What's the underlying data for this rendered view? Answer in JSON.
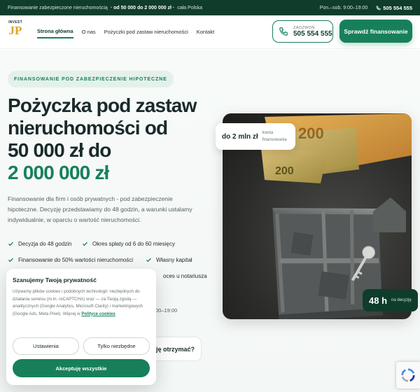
{
  "topbar": {
    "text_a": "Finansowanie zabezpieczone nieruchomością",
    "text_b": "· od 50 000 do 2 000 000 zł ·",
    "text_c": "cała Polska",
    "hours": "Pon.–sob. 9:00–19:00",
    "phone": "505 554 555"
  },
  "logo": {
    "top": "INVEST",
    "mark": "JP"
  },
  "nav": [
    "Strona główna",
    "O nas",
    "Pożyczki pod zastaw nieruchomości",
    "Kontakt"
  ],
  "call": {
    "label": "ZADZWOŃ",
    "phone": "505 554 555"
  },
  "cta_top": "Sprawdź finansowanie",
  "hero": {
    "pill": "FINANSOWANIE POD ZABEZPIECZENIE HIPOTECZNE",
    "h1_line1": "Pożyczka pod zastaw",
    "h1_line2": "nieruchomości od",
    "h1_line3": "50 000 zł do",
    "h1_green": "2 000 000 zł",
    "lead": "Finansowanie dla firm i osób prywatnych - pod zabezpieczenie hipoteczne. Decyzję przedstawiamy do 48 godzin, a warunki ustalamy indywidualnie, w oparciu o wartość nieruchomości.",
    "features": [
      "Decyzja do 48 godzin",
      "Okres spłaty od 6 do 60 miesięcy",
      "Finansowanie do 50% wartości nieruchomości",
      "Własny kapitał",
      "oces u notariusza"
    ],
    "hours_fragment": "00–19:00",
    "secondary_button": "ję otrzymać?"
  },
  "image_card": {
    "badge_top_big": "do 2 mln zł",
    "badge_top_small_1": "kwota",
    "badge_top_small_2": "finansowania",
    "badge_bot_big": "48 h",
    "badge_bot_small": "na decyzję",
    "banknote_value": "200"
  },
  "cookie": {
    "title": "Szanujemy Twoją prywatność",
    "body": "Używamy plików cookies i podobnych technologii: niezbędnych do działania serwisu (m.in. reCAPTCHA) oraz — za Twoją zgodą — analitycznych (Google Analytics, Microsoft Clarity) i marketingowych (Google Ads, Meta Pixel). Więcej w",
    "link": "Polityce cookies",
    "btn_settings": "Ustawienia",
    "btn_necessary": "Tylko niezbędne",
    "btn_accept": "Akceptuję wszystkie"
  },
  "colors": {
    "brand_dark": "#0f3d2b",
    "brand": "#17805a",
    "gold": "#d9a421"
  }
}
